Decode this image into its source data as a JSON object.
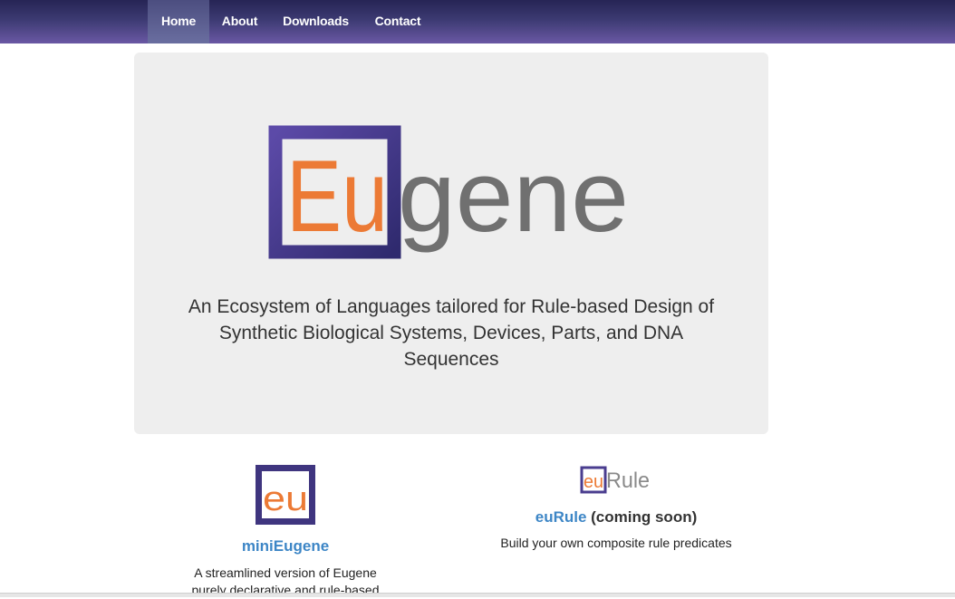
{
  "nav": {
    "items": [
      {
        "label": "Home",
        "active": true
      },
      {
        "label": "About",
        "active": false
      },
      {
        "label": "Downloads",
        "active": false
      },
      {
        "label": "Contact",
        "active": false
      }
    ]
  },
  "hero": {
    "logo": {
      "box_text": "Eu",
      "rest_text": "gene"
    },
    "tagline_lines": [
      "An Ecosystem of Languages tailored for Rule-based Design of",
      "Synthetic Biological Systems, Devices, Parts, and DNA",
      "Sequences"
    ]
  },
  "features": {
    "minieugene": {
      "icon_text": "eu",
      "title": "miniEugene",
      "desc_lines": [
        "A streamlined version of Eugene",
        "purely declarative and rule-based"
      ]
    },
    "eurule": {
      "icon_box_text": "eu",
      "icon_rest_text": "Rule",
      "title_link": "euRule",
      "title_rest": " (coming soon)",
      "desc": "Build your own composite rule predicates"
    }
  },
  "colors": {
    "nav_top": "#262455",
    "nav_bottom": "#6a58a4",
    "logo_box": "#4a3d8f",
    "logo_orange": "#ec7a35",
    "logo_gray": "#707070",
    "link_blue": "#3d86c6",
    "hero_bg": "#eeeeee"
  }
}
